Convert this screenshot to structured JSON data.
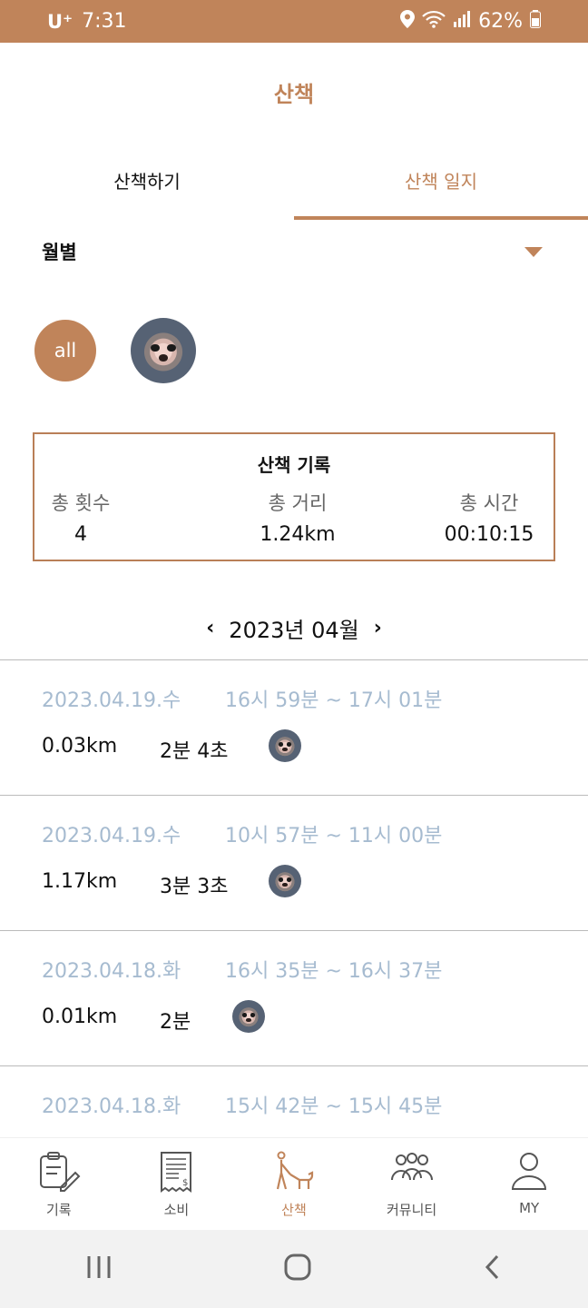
{
  "status": {
    "carrier": "U⁺",
    "time": "7:31",
    "battery": "62%"
  },
  "header": {
    "title": "산책"
  },
  "tabs": [
    {
      "label": "산책하기",
      "active": false
    },
    {
      "label": "산책 일지",
      "active": true
    }
  ],
  "filter": {
    "selected": "월별"
  },
  "pets": {
    "all_label": "all"
  },
  "summary": {
    "title": "산책 기록",
    "stats": [
      {
        "label": "총 횟수",
        "value": "4"
      },
      {
        "label": "총 거리",
        "value": "1.24km"
      },
      {
        "label": "총 시간",
        "value": "00:10:15"
      }
    ]
  },
  "month_nav": {
    "label": "2023년 04월"
  },
  "walks": [
    {
      "date": "2023.04.19.수",
      "time": "16시 59분 ~ 17시 01분",
      "distance": "0.03km",
      "duration": "2분 4초"
    },
    {
      "date": "2023.04.19.수",
      "time": "10시 57분 ~ 11시 00분",
      "distance": "1.17km",
      "duration": "3분 3초"
    },
    {
      "date": "2023.04.18.화",
      "time": "16시 35분 ~ 16시 37분",
      "distance": "0.01km",
      "duration": "2분"
    },
    {
      "date": "2023.04.18.화",
      "time": "15시 42분 ~ 15시 45분",
      "distance": "",
      "duration": ""
    }
  ],
  "bottom_nav": [
    {
      "label": "기록",
      "icon": "clipboard-icon",
      "active": false
    },
    {
      "label": "소비",
      "icon": "receipt-icon",
      "active": false
    },
    {
      "label": "산책",
      "icon": "dog-walk-icon",
      "active": true
    },
    {
      "label": "커뮤니티",
      "icon": "community-icon",
      "active": false
    },
    {
      "label": "MY",
      "icon": "person-icon",
      "active": false
    }
  ],
  "colors": {
    "accent": "#c0845a",
    "muted_blue": "#a6bbd0"
  }
}
